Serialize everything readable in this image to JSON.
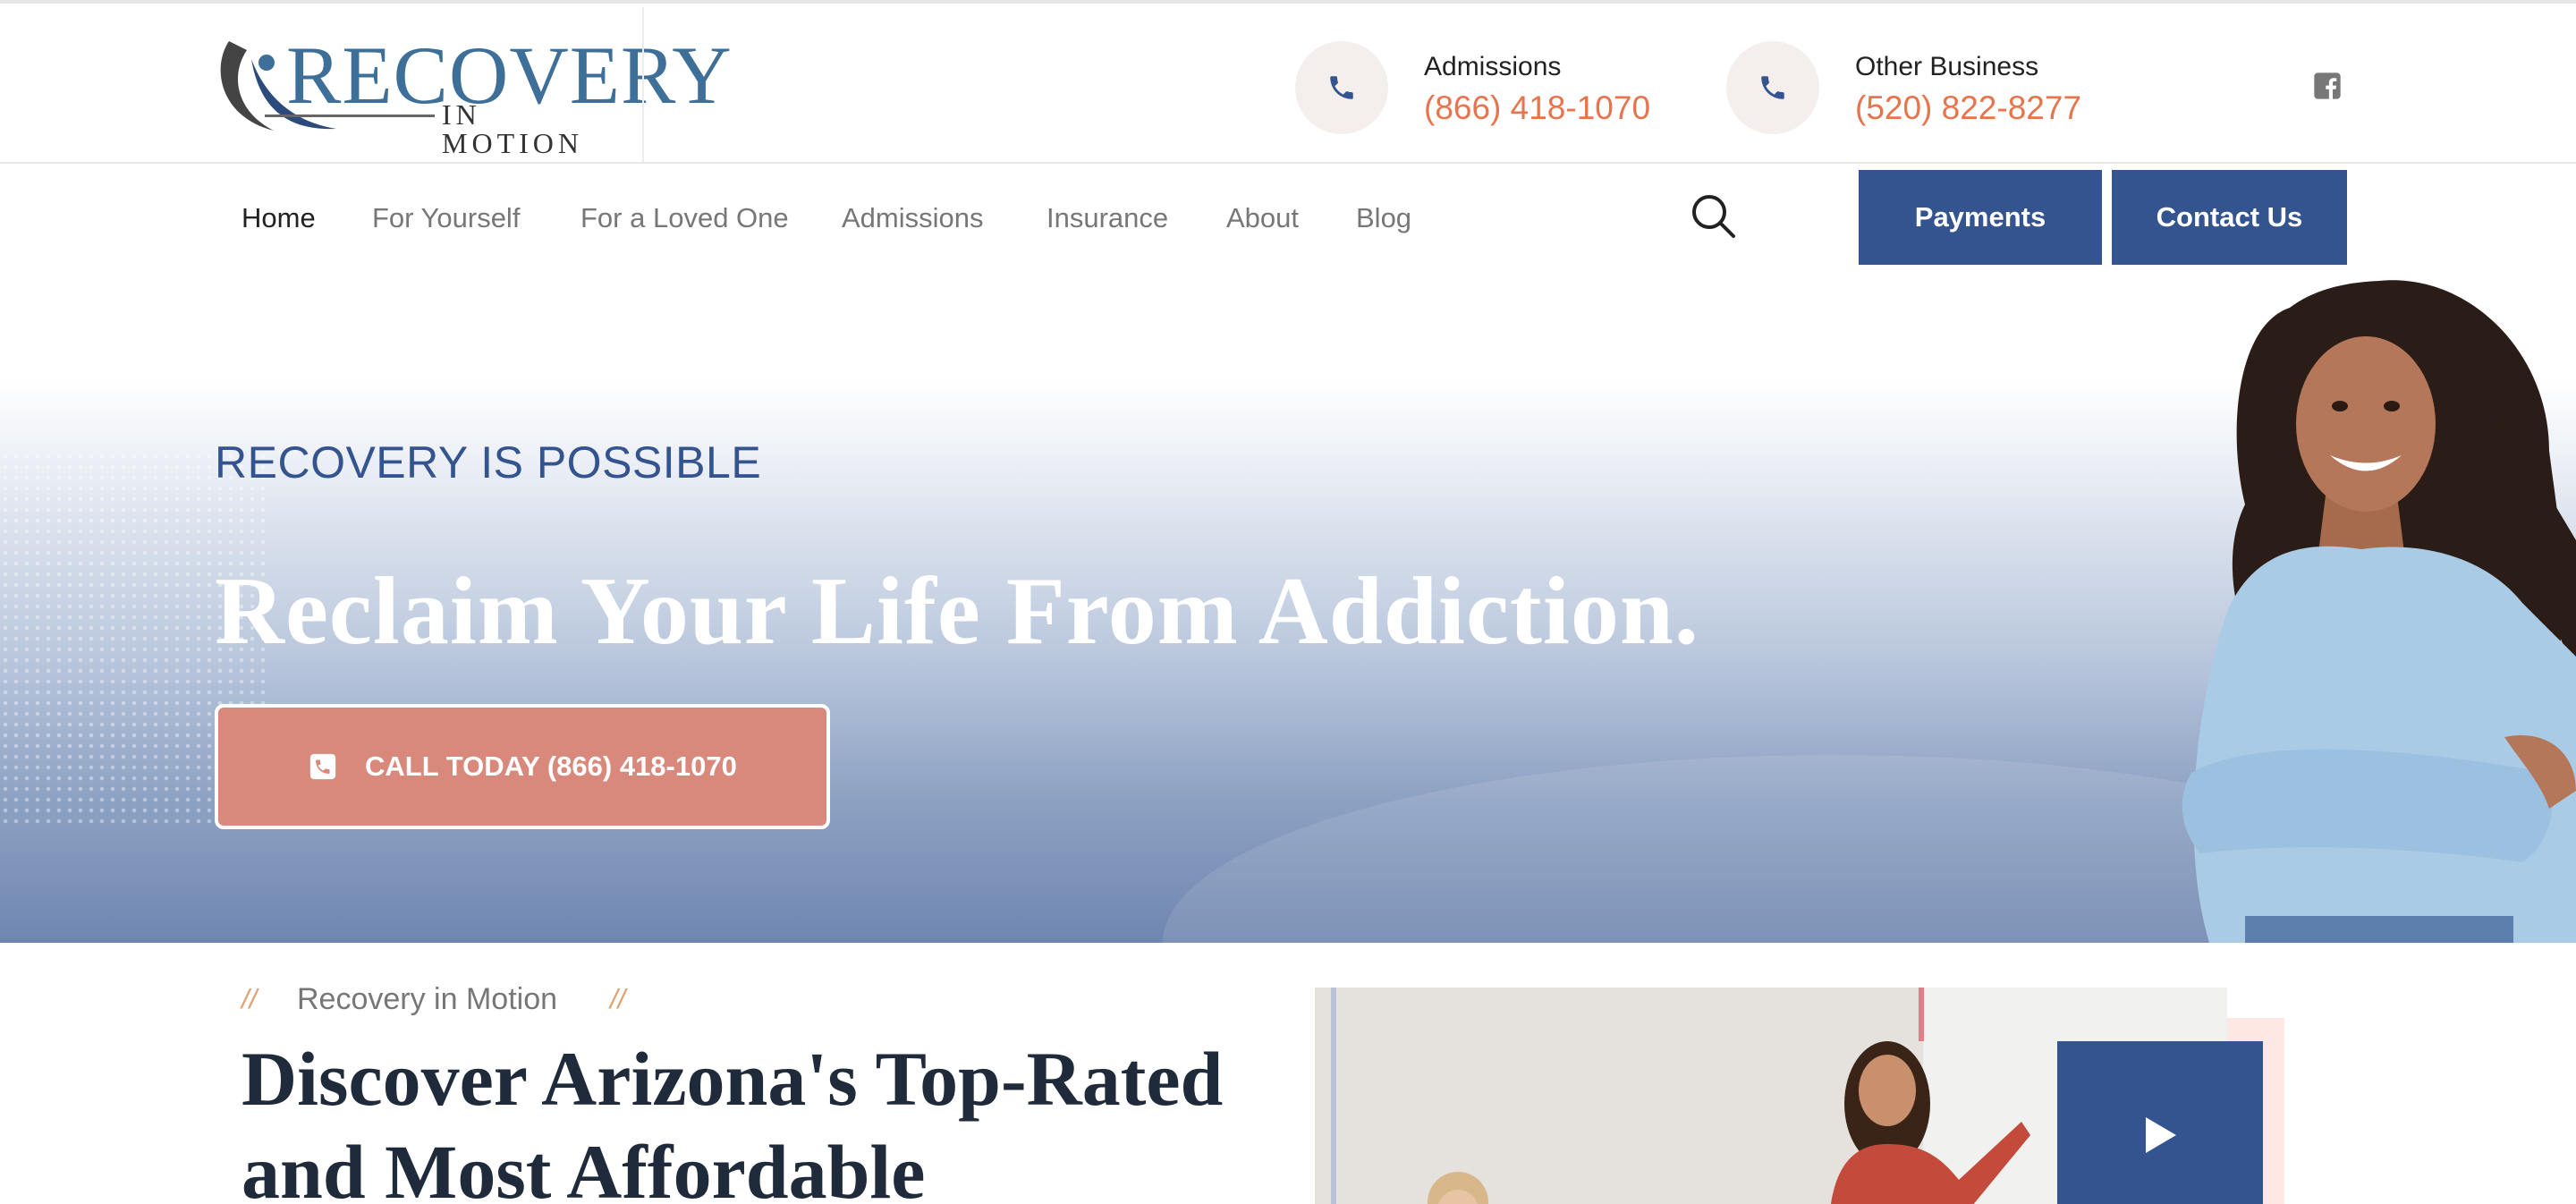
{
  "brand": {
    "logo_main": "RECOVERY",
    "logo_sub": "IN MOTION",
    "primary_color": "#34548f",
    "accent_color": "#e8744d"
  },
  "contacts": [
    {
      "label": "Admissions",
      "phone": "(866) 418-1070",
      "icon": "phone-icon"
    },
    {
      "label": "Other Business",
      "phone": "(520) 822-8277",
      "icon": "phone-icon"
    }
  ],
  "social": {
    "icon": "facebook-icon"
  },
  "nav": {
    "items": [
      "Home",
      "For Yourself",
      "For a Loved One",
      "Admissions",
      "Insurance",
      "About",
      "Blog"
    ],
    "active": "Home",
    "payments_label": "Payments",
    "contact_label": "Contact Us"
  },
  "hero": {
    "eyebrow": "RECOVERY IS POSSIBLE",
    "title": "Reclaim Your Life From Addiction.",
    "cta_label": "CALL TODAY (866) 418-1070"
  },
  "about": {
    "eyebrow": "Recovery in Motion",
    "slash": "//",
    "title": "Discover Arizona's Top-Rated and Most Affordable"
  }
}
